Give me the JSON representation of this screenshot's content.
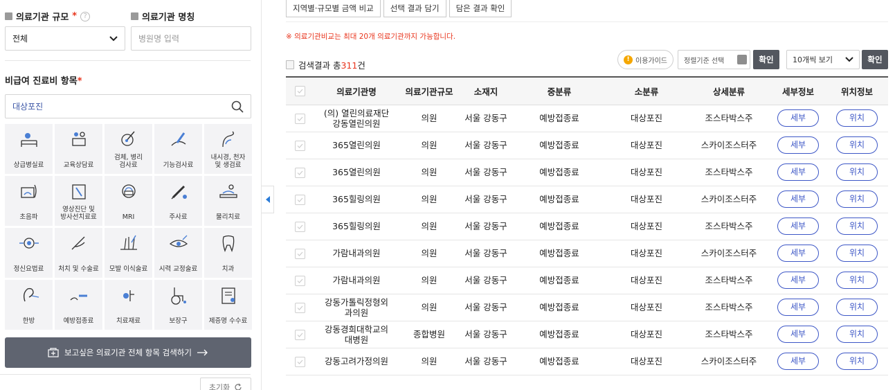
{
  "filters": {
    "scale_label": "의료기관 규모",
    "scale_value": "전체",
    "name_label": "의료기관 명칭",
    "name_placeholder": "병원명 입력",
    "required_mark": "*",
    "help_mark": "?"
  },
  "categories": {
    "heading": "비급여 진료비 항목",
    "search_value": "대상포진",
    "items": [
      {
        "label": "상급병실료",
        "icon": "hospital-bed-icon"
      },
      {
        "label": "교육상담료",
        "icon": "counseling-icon"
      },
      {
        "label": "검체, 병리\n검사료",
        "icon": "lab-test-icon"
      },
      {
        "label": "기능검사료",
        "icon": "function-test-icon"
      },
      {
        "label": "내시경, 천자\n및 생검료",
        "icon": "endoscope-icon"
      },
      {
        "label": "초음파",
        "icon": "ultrasound-icon"
      },
      {
        "label": "영상진단 및\n방사선치료료",
        "icon": "radiology-icon"
      },
      {
        "label": "MRI",
        "icon": "mri-icon"
      },
      {
        "label": "주사료",
        "icon": "syringe-icon"
      },
      {
        "label": "물리치료",
        "icon": "physical-therapy-icon"
      },
      {
        "label": "정신요법료",
        "icon": "brain-icon"
      },
      {
        "label": "처치 및 수술료",
        "icon": "surgery-icon"
      },
      {
        "label": "모발 이식술료",
        "icon": "hair-transplant-icon"
      },
      {
        "label": "시력 교정술료",
        "icon": "eye-icon"
      },
      {
        "label": "치과",
        "icon": "tooth-icon"
      },
      {
        "label": "한방",
        "icon": "ear-acupuncture-icon"
      },
      {
        "label": "예방접종료",
        "icon": "vaccine-icon"
      },
      {
        "label": "치료재료",
        "icon": "material-icon"
      },
      {
        "label": "보장구",
        "icon": "wheelchair-icon"
      },
      {
        "label": "제증명 수수료",
        "icon": "certificate-icon"
      }
    ],
    "search_all_button": "보고싶은 의료기관 전체 항목 검색하기",
    "reset_button": "초기화"
  },
  "toolbar": {
    "compare_button": "지역별·규모별 금액 비교",
    "add_button": "선택 결과 담기",
    "view_button": "담은 결과 확인",
    "notice": "※ 의료기관비교는 최대 20개 의료기관까지 가능합니다.",
    "result_prefix": "검색결과 총",
    "result_count": "311",
    "result_suffix": "건",
    "guide_label": "이용가이드",
    "sort_label": "정렬기준 선택",
    "confirm_label": "확인",
    "page_size_label": "10개씩 보기"
  },
  "table": {
    "headers": [
      "의료기관명",
      "의료기관규모",
      "소재지",
      "중분류",
      "소분류",
      "상세분류",
      "세부정보",
      "위치정보"
    ],
    "detail_label": "세부",
    "location_label": "위치",
    "rows": [
      [
        "(의) 열린의료재단\n강동열린의원",
        "의원",
        "서울 강동구",
        "예방접종료",
        "대상포진",
        "조스타박스주"
      ],
      [
        "365열린의원",
        "의원",
        "서울 강동구",
        "예방접종료",
        "대상포진",
        "스카이조스터주"
      ],
      [
        "365열린의원",
        "의원",
        "서울 강동구",
        "예방접종료",
        "대상포진",
        "조스타박스주"
      ],
      [
        "365힐링의원",
        "의원",
        "서울 강동구",
        "예방접종료",
        "대상포진",
        "스카이조스터주"
      ],
      [
        "365힐링의원",
        "의원",
        "서울 강동구",
        "예방접종료",
        "대상포진",
        "조스타박스주"
      ],
      [
        "가람내과의원",
        "의원",
        "서울 강동구",
        "예방접종료",
        "대상포진",
        "스카이조스터주"
      ],
      [
        "가람내과의원",
        "의원",
        "서울 강동구",
        "예방접종료",
        "대상포진",
        "조스타박스주"
      ],
      [
        "강동가톨릭정형외\n과의원",
        "의원",
        "서울 강동구",
        "예방접종료",
        "대상포진",
        "조스타박스주"
      ],
      [
        "강동경희대학교의\n대병원",
        "종합병원",
        "서울 강동구",
        "예방접종료",
        "대상포진",
        "조스타박스주"
      ],
      [
        "강동고려가정의원",
        "의원",
        "서울 강동구",
        "예방접종료",
        "대상포진",
        "스카이조스터주"
      ]
    ]
  },
  "colors": {
    "accent_red": "#e8341c",
    "accent_blue": "#3c56c6",
    "dark_button": "#5f6470"
  }
}
